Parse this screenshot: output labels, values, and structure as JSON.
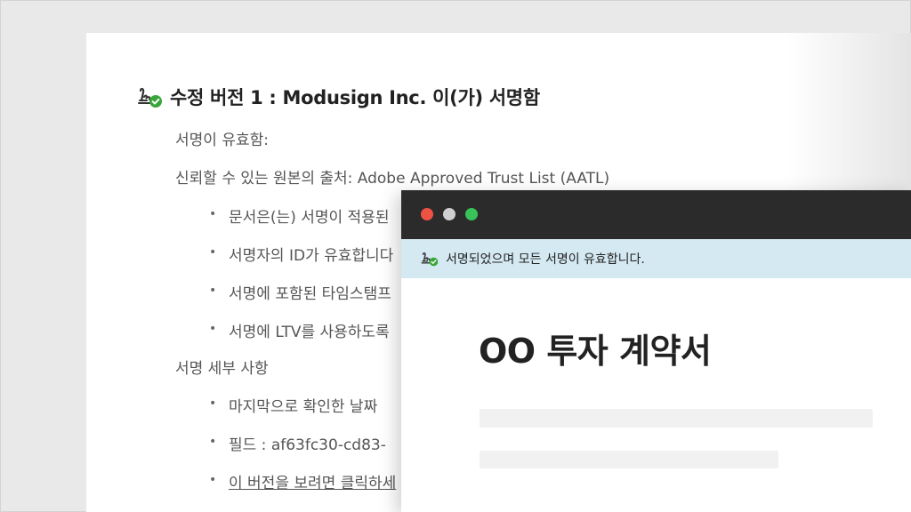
{
  "signature_panel": {
    "title": "수정 버전 1 : Modusign Inc. 이(가) 서명함",
    "valid_text": "서명이 유효함:",
    "trust_source": "신뢰할 수 있는 원본의 출처: Adobe Approved Trust List (AATL)",
    "validity_items": [
      "문서은(는) 서명이 적용된",
      "서명자의 ID가 유효합니다",
      "서명에 포함된 타임스탬프",
      "서명에 LTV를 사용하도록"
    ],
    "details_heading": "서명 세부 사항",
    "detail_items": [
      "마지막으로 확인한 날짜",
      "필드 : af63fc30-cd83-"
    ],
    "view_version_link": "이 버전을 보려면 클릭하세"
  },
  "viewer_window": {
    "banner_text": "서명되었으며 모든 서명이 유효합니다.",
    "document_title": "OO 투자 계약서"
  },
  "icons": {
    "signature_valid": "signature-check-icon",
    "close": "window-close-dot",
    "minimize": "window-minimize-dot",
    "maximize": "window-maximize-dot"
  },
  "colors": {
    "check_green": "#3aa63a",
    "banner_bg": "#d5e9f2",
    "titlebar_bg": "#2b2b2b",
    "close_dot": "#ee5245",
    "minimize_dot": "#cfcfcf",
    "maximize_dot": "#39c25a"
  }
}
